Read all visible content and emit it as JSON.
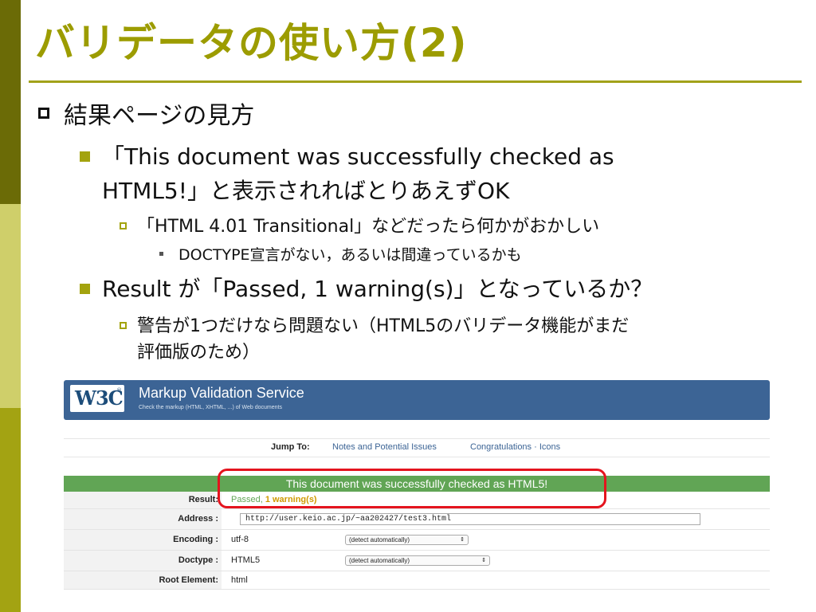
{
  "slide": {
    "title": "バリデータの使い方(2)",
    "bullets": {
      "b1": "結果ページの見方",
      "b2_line1": "「This document was successfully checked as",
      "b2_line2": "HTML5!」と表示されればとりあえずOK",
      "b3": "「HTML 4.01 Transitional」などだったら何かがおかしい",
      "b4": "DOCTYPE宣言がない，あるいは間違っているかも",
      "b5": "Result が「Passed, 1 warning(s)」となっているか？",
      "b6_line1": "警告が1つだけなら問題ない（HTML5のバリデータ機能がまだ",
      "b6_line2": "評価版のため）"
    }
  },
  "validator": {
    "logo_text": "W3C",
    "logo_reg": "®",
    "service_title": "Markup Validation Service",
    "service_subtitle": "Check the markup (HTML, XHTML, ...) of Web documents",
    "jump_label": "Jump To:",
    "jump_link1": "Notes and Potential Issues",
    "jump_link2": "Congratulations · Icons",
    "result_banner": "This document was successfully checked as HTML5!",
    "result_label": "Result:",
    "result_passed": "Passed, ",
    "result_warning": "1 warning(s)",
    "address_label": "Address :",
    "address_value": "http://user.keio.ac.jp/~aa202427/test3.html",
    "encoding_label": "Encoding :",
    "encoding_value": "utf-8",
    "encoding_select": "(detect automatically)",
    "doctype_label": "Doctype :",
    "doctype_value": "HTML5",
    "doctype_select": "(detect automatically)",
    "root_label": "Root Element:",
    "root_value": "html",
    "select_arrow": "⇕"
  },
  "colors": {
    "title_olive": "#9c9c00",
    "w3c_blue": "#3c6495",
    "pass_green": "#61a555",
    "highlight_red": "#e4141e"
  }
}
